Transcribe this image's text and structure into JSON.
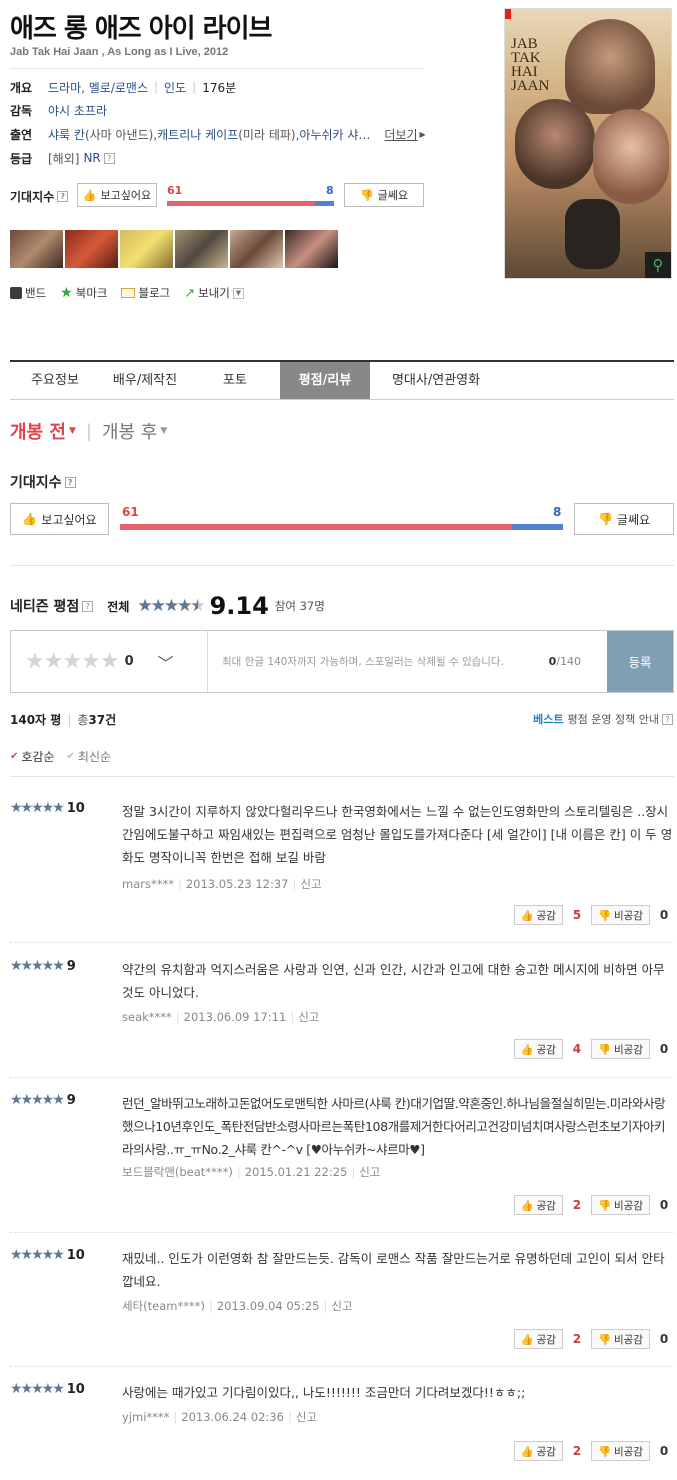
{
  "movie": {
    "title": "애즈 롱 애즈 아이 라이브",
    "subtitle": "Jab Tak Hai Jaan , As Long as I Live, 2012",
    "overview_label": "개요",
    "genre": "드라마, 멜로/로맨스",
    "country": "인도",
    "runtime": "176분",
    "director_label": "감독",
    "director": "야시 초프라",
    "cast_label": "출연",
    "cast_1": "샤룩 칸",
    "cast_1_role": "(사마 아낸드), ",
    "cast_2": "캐트리나 케이프",
    "cast_2_role": "(미라 테파), ",
    "cast_3": "아누쉬카 샤…",
    "more": "더보기",
    "rating_label": "등급",
    "rating_region": "[해외]",
    "rating": "NR",
    "poster_title": "JAB TAK HAI JAAN"
  },
  "expect_small": {
    "label": "기대지수",
    "want_label": "보고싶어요",
    "want_count": "61",
    "meh_count": "8",
    "meh_label": "글쎄요",
    "want_ratio": 0.884
  },
  "share": {
    "band": "밴드",
    "bookmark": "북마크",
    "blog": "블로그",
    "export": "보내기"
  },
  "tabs": [
    "주요정보",
    "배우/제작진",
    "포토",
    "평점/리뷰",
    "명대사/연관영화"
  ],
  "active_tab": 3,
  "release_filter": {
    "before": "개봉 전",
    "after": "개봉 후"
  },
  "expect": {
    "heading": "기대지수",
    "want_label": "보고싶어요",
    "want_count": "61",
    "meh_count": "8",
    "meh_label": "글쎄요",
    "want_ratio": 0.884
  },
  "netizen": {
    "heading": "네티즌 평점",
    "overall_label": "전체",
    "score": "9.14",
    "participants": "참여 37명",
    "star_fill": 0.914
  },
  "write": {
    "score": "0",
    "placeholder": "최대 한글 140자까지 가능하며, 스포일러는 삭제될 수 있습니다.",
    "count": "0",
    "max": "/140",
    "submit": "등록"
  },
  "list": {
    "label": "140자 평",
    "total_prefix": "총",
    "total": "37건",
    "best_label": "베스트",
    "policy": "평점 운영 정책 안내",
    "sort_sympathy": "호감순",
    "sort_recent": "최신순"
  },
  "vote_labels": {
    "up": "공감",
    "down": "비공감"
  },
  "reviews": [
    {
      "stars": "★★★★★",
      "score": "10",
      "text": "정말 3시간이 지루하지 않았다헐리우드나 한국영화에서는 느낄 수 없는인도영화만의 스토리텔링은 ..장시간임에도불구하고 짜임새있는 편집력으로 엄청난 몰입도를가져다준다 [세 얼간이] [내 이름은 칸] 이 두 영화도 명작이니꼭 한번은 접해 보길 바람",
      "user": "mars****",
      "date": "2013.05.23 12:37",
      "report": "신고",
      "up": "5",
      "down": "0"
    },
    {
      "stars": "★★★★★",
      "score": "9",
      "text": "약간의 유치함과 억지스러움은 사랑과 인연, 신과 인간, 시간과 인고에 대한 숭고한 메시지에 비하면 아무것도 아니었다.",
      "user": "seak****",
      "date": "2013.06.09 17:11",
      "report": "신고",
      "up": "4",
      "down": "0"
    },
    {
      "stars": "★★★★★",
      "score": "9",
      "text": "런던_알바뛰고노래하고돈없어도로맨틱한 사마르(샤룩 칸)대기업딸.약혼중인.하나님을절실히믿는.미라와사랑했으나10년후인도_폭탄전담반소령사마르는폭탄108개를제거한다어리고건강미넘치며사랑스런초보기자아키라의사랑..ㅠ_ㅠNo.2_샤룩 칸^-^v [♥아누쉬카~샤르마♥]",
      "user": "보드블락맨(beat****)",
      "date": "2015.01.21 22:25",
      "report": "신고",
      "up": "2",
      "down": "0"
    },
    {
      "stars": "★★★★★",
      "score": "10",
      "text": "재밌네.. 인도가 이런영화 참 잘만드는듯. 감독이 로맨스 작품 잘만드는거로 유명하던데 고인이 되서 안타깝네요.",
      "user": "세타(team****)",
      "date": "2013.09.04 05:25",
      "report": "신고",
      "up": "2",
      "down": "0"
    },
    {
      "stars": "★★★★★",
      "score": "10",
      "text": "사랑에는 때가있고 기다림이있다,, 나도!!!!!!! 조금만더 기다려보겠다!!ㅎㅎ;;",
      "user": "yjmi****",
      "date": "2013.06.24 02:36",
      "report": "신고",
      "up": "2",
      "down": "0"
    }
  ]
}
